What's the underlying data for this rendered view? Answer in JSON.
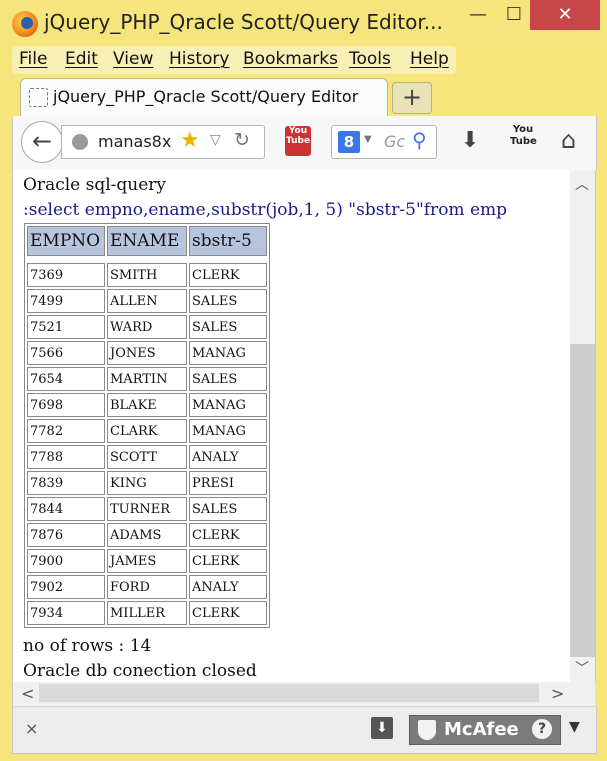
{
  "window": {
    "title": "jQuery_PHP_Qracle Scott/Query Editor...",
    "min": "—",
    "max": "☐",
    "close": "✕"
  },
  "menu": [
    "File",
    "Edit",
    "View",
    "History",
    "Bookmarks",
    "Tools",
    "Help"
  ],
  "tab": {
    "title": "jQuery_PHP_Qracle Scott/Query Editor",
    "new_tab": "+"
  },
  "nav": {
    "back": "←",
    "url": "manas8x",
    "search_placeholder": "Gc",
    "search_engine": "8",
    "youtube_label": "You Tube",
    "yt_user_label": "You Tube"
  },
  "content": {
    "heading": "Oracle sql-query",
    "sql": ":select empno,ename,substr(job,1, 5) \"sbstr-5\"from emp",
    "columns": [
      "EMPNO",
      "ENAME",
      "sbstr-5"
    ],
    "rows": [
      [
        "7369",
        "SMITH",
        "CLERK"
      ],
      [
        "7499",
        "ALLEN",
        "SALES"
      ],
      [
        "7521",
        "WARD",
        "SALES"
      ],
      [
        "7566",
        "JONES",
        "MANAG"
      ],
      [
        "7654",
        "MARTIN",
        "SALES"
      ],
      [
        "7698",
        "BLAKE",
        "MANAG"
      ],
      [
        "7782",
        "CLARK",
        "MANAG"
      ],
      [
        "7788",
        "SCOTT",
        "ANALY"
      ],
      [
        "7839",
        "KING",
        "PRESI"
      ],
      [
        "7844",
        "TURNER",
        "SALES"
      ],
      [
        "7876",
        "ADAMS",
        "CLERK"
      ],
      [
        "7900",
        "JAMES",
        "CLERK"
      ],
      [
        "7902",
        "FORD",
        "ANALY"
      ],
      [
        "7934",
        "MILLER",
        "CLERK"
      ]
    ],
    "rows_count": "no of rows : 14",
    "closed_msg": "Oracle db conection closed"
  },
  "addon": {
    "close": "×",
    "mcafee": "McAfee",
    "help": "?"
  },
  "colors": {
    "titlebar": "#f6e57d",
    "header_bg": "#b6c4de",
    "sql_text": "#1a1a8a"
  }
}
